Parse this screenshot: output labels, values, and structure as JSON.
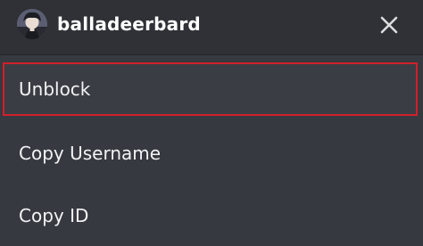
{
  "header": {
    "username": "balladeerbard",
    "avatar_icon": "user-avatar",
    "close_icon": "close-icon"
  },
  "menu": {
    "items": [
      {
        "label": "Unblock",
        "highlight_color": "#d21f2b"
      },
      {
        "label": "Copy Username"
      },
      {
        "label": "Copy ID"
      }
    ]
  },
  "colors": {
    "background": "#36393f",
    "header_background": "#2f3136",
    "text": "#f2f3f5",
    "accent_border": "#d21f2b"
  }
}
